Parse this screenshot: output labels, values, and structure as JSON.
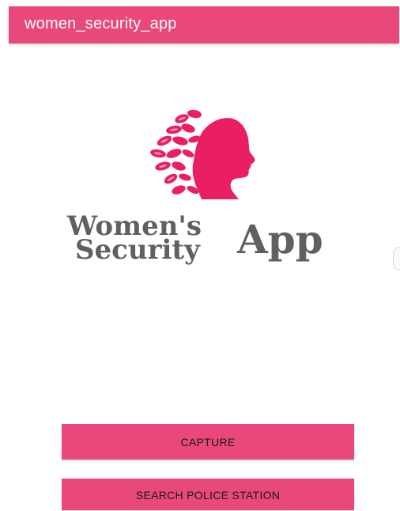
{
  "app_bar": {
    "title": "women_security_app"
  },
  "logo": {
    "line1": "Women's",
    "line2": "Security",
    "line3": "App",
    "accent_color": "#e8497a",
    "text_color": "#606060"
  },
  "buttons": {
    "capture": "CAPTURE",
    "search_police_station": "SEARCH POLICE STATION"
  },
  "colors": {
    "primary": "#e8497a",
    "background": "#ffffff"
  }
}
